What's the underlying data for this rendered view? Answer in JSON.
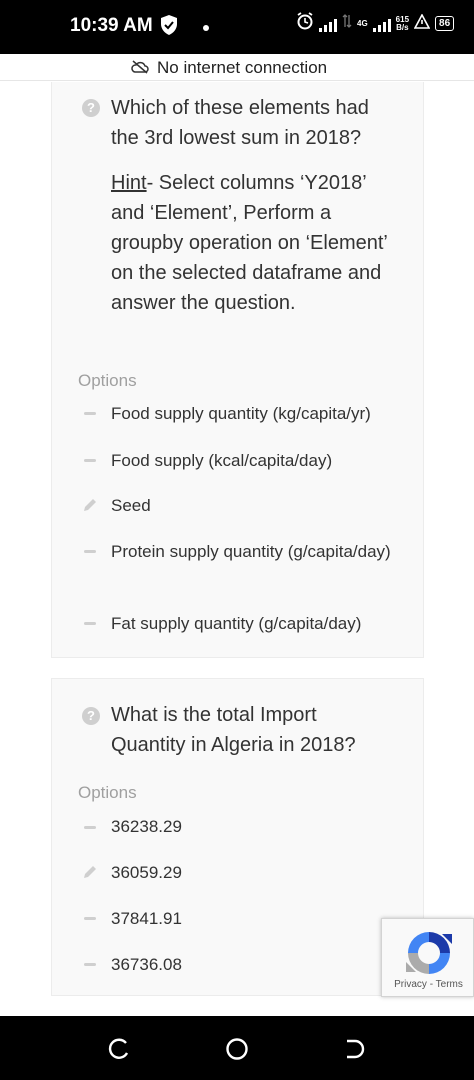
{
  "status": {
    "time": "10:39 AM",
    "network_type": "4G",
    "net_speed_value": "615",
    "net_speed_unit": "B/s",
    "battery": "86"
  },
  "offline_banner": "No internet connection",
  "question1": {
    "text": "Which of these elements had the 3rd lowest sum in 2018?",
    "hint_label": "Hint",
    "hint_text": "- Select columns ‘Y2018’ and ‘Element’, Perform a groupby operation on ‘Element’ on the selected dataframe and answer the question.",
    "options_label": "Options",
    "options": [
      {
        "text": "Food supply quantity (kg/capita/yr)",
        "marker": "dash"
      },
      {
        "text": "Food supply (kcal/capita/day)",
        "marker": "dash"
      },
      {
        "text": "Seed",
        "marker": "pencil"
      },
      {
        "text": "Protein supply quantity (g/capita/day)",
        "marker": "dash"
      },
      {
        "text": "Fat supply quantity (g/capita/day)",
        "marker": "dash"
      }
    ]
  },
  "question2": {
    "text": "What is the total Import Quantity in Algeria in 2018?",
    "options_label": "Options",
    "options": [
      {
        "text": "36238.29",
        "marker": "dash"
      },
      {
        "text": "36059.29",
        "marker": "pencil"
      },
      {
        "text": "37841.91",
        "marker": "dash"
      },
      {
        "text": "36736.08",
        "marker": "dash"
      }
    ]
  },
  "recaptcha": {
    "privacy": "Privacy",
    "separator": "-",
    "terms": "Terms"
  }
}
